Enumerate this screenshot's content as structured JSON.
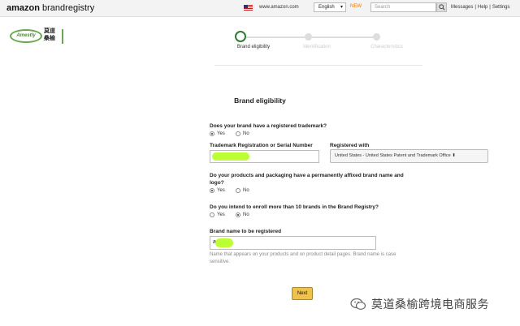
{
  "header": {
    "logo_word": "amazon",
    "logo_brand": " brandregistry",
    "site": "www.amazon.com",
    "language": "English",
    "new_badge": "NEW",
    "search_placeholder": "Search",
    "links": [
      "Messages",
      "|",
      "Help",
      "|",
      "Settings"
    ]
  },
  "partner": {
    "badge_text": "Amestly",
    "cn_line1": "莫道",
    "cn_line2": "桑榆"
  },
  "steps": [
    {
      "label": "Brand eligibility",
      "state": "active"
    },
    {
      "label": "Identification",
      "state": "idle"
    },
    {
      "label": "Characteristics",
      "state": "idle"
    }
  ],
  "form": {
    "title": "Brand eligibility",
    "q1": "Does your brand have a registered trademark?",
    "q1_yes": "Yes",
    "q1_no": "No",
    "tm_label": "Trademark Registration or Serial Number",
    "registered_with_label": "Registered with",
    "registered_with_value": "United States - United States Patent and Trademark Office",
    "q2": "Do your products and packaging have a permanently affixed brand name and logo?",
    "q2_yes": "Yes",
    "q2_no": "No",
    "q3": "Do you intend to enroll more than 10 brands in the Brand Registry?",
    "q3_yes": "Yes",
    "q3_no": "No",
    "brand_label": "Brand name to be registered",
    "brand_value": "a",
    "help": "Name that appears on your products and on product detail pages. Brand name is case sensitive.",
    "next": "Next"
  },
  "watermark": "莫道桑榆跨境电商服务",
  "colors": {
    "accent_green": "#2e7d32",
    "button_yellow": "#f0c14b",
    "highlight": "#b8ff2a"
  }
}
